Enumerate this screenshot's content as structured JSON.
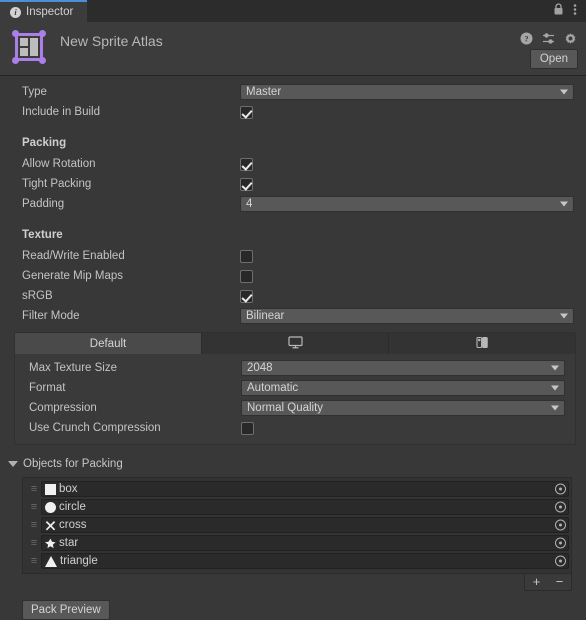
{
  "window": {
    "tab_label": "Inspector",
    "tab_icon": "info-icon",
    "lock_icon": "lock-icon",
    "menu_icon": "kebab-menu-icon"
  },
  "object_header": {
    "title": "New Sprite Atlas",
    "icon": "sprite-atlas-icon",
    "help_icon": "help-icon",
    "preset_icon": "preset-icon",
    "settings_icon": "gear-icon",
    "open_label": "Open"
  },
  "properties": {
    "type": {
      "label": "Type",
      "value": "Master"
    },
    "include_in_build": {
      "label": "Include in Build",
      "checked": true
    }
  },
  "packing": {
    "section_label": "Packing",
    "allow_rotation": {
      "label": "Allow Rotation",
      "checked": true
    },
    "tight_packing": {
      "label": "Tight Packing",
      "checked": true
    },
    "padding": {
      "label": "Padding",
      "value": "4"
    }
  },
  "texture": {
    "section_label": "Texture",
    "read_write": {
      "label": "Read/Write Enabled",
      "checked": false
    },
    "mip_maps": {
      "label": "Generate Mip Maps",
      "checked": false
    },
    "srgb": {
      "label": "sRGB",
      "checked": true
    },
    "filter_mode": {
      "label": "Filter Mode",
      "value": "Bilinear"
    }
  },
  "platform": {
    "tabs": [
      {
        "label": "Default",
        "icon": "",
        "active": true
      },
      {
        "label": "",
        "icon": "monitor-icon",
        "active": false
      },
      {
        "label": "",
        "icon": "switch-console-icon",
        "active": false
      }
    ],
    "max_texture_size": {
      "label": "Max Texture Size",
      "value": "2048"
    },
    "format": {
      "label": "Format",
      "value": "Automatic"
    },
    "compression": {
      "label": "Compression",
      "value": "Normal Quality"
    },
    "crunch": {
      "label": "Use Crunch Compression",
      "checked": false
    }
  },
  "objects_for_packing": {
    "label": "Objects for Packing",
    "items": [
      {
        "name": "box",
        "shape": "square"
      },
      {
        "name": "circle",
        "shape": "circle"
      },
      {
        "name": "cross",
        "shape": "cross"
      },
      {
        "name": "star",
        "shape": "star"
      },
      {
        "name": "triangle",
        "shape": "triangle"
      }
    ],
    "add_label": "+",
    "remove_label": "−"
  },
  "footer": {
    "pack_preview_label": "Pack Preview"
  }
}
